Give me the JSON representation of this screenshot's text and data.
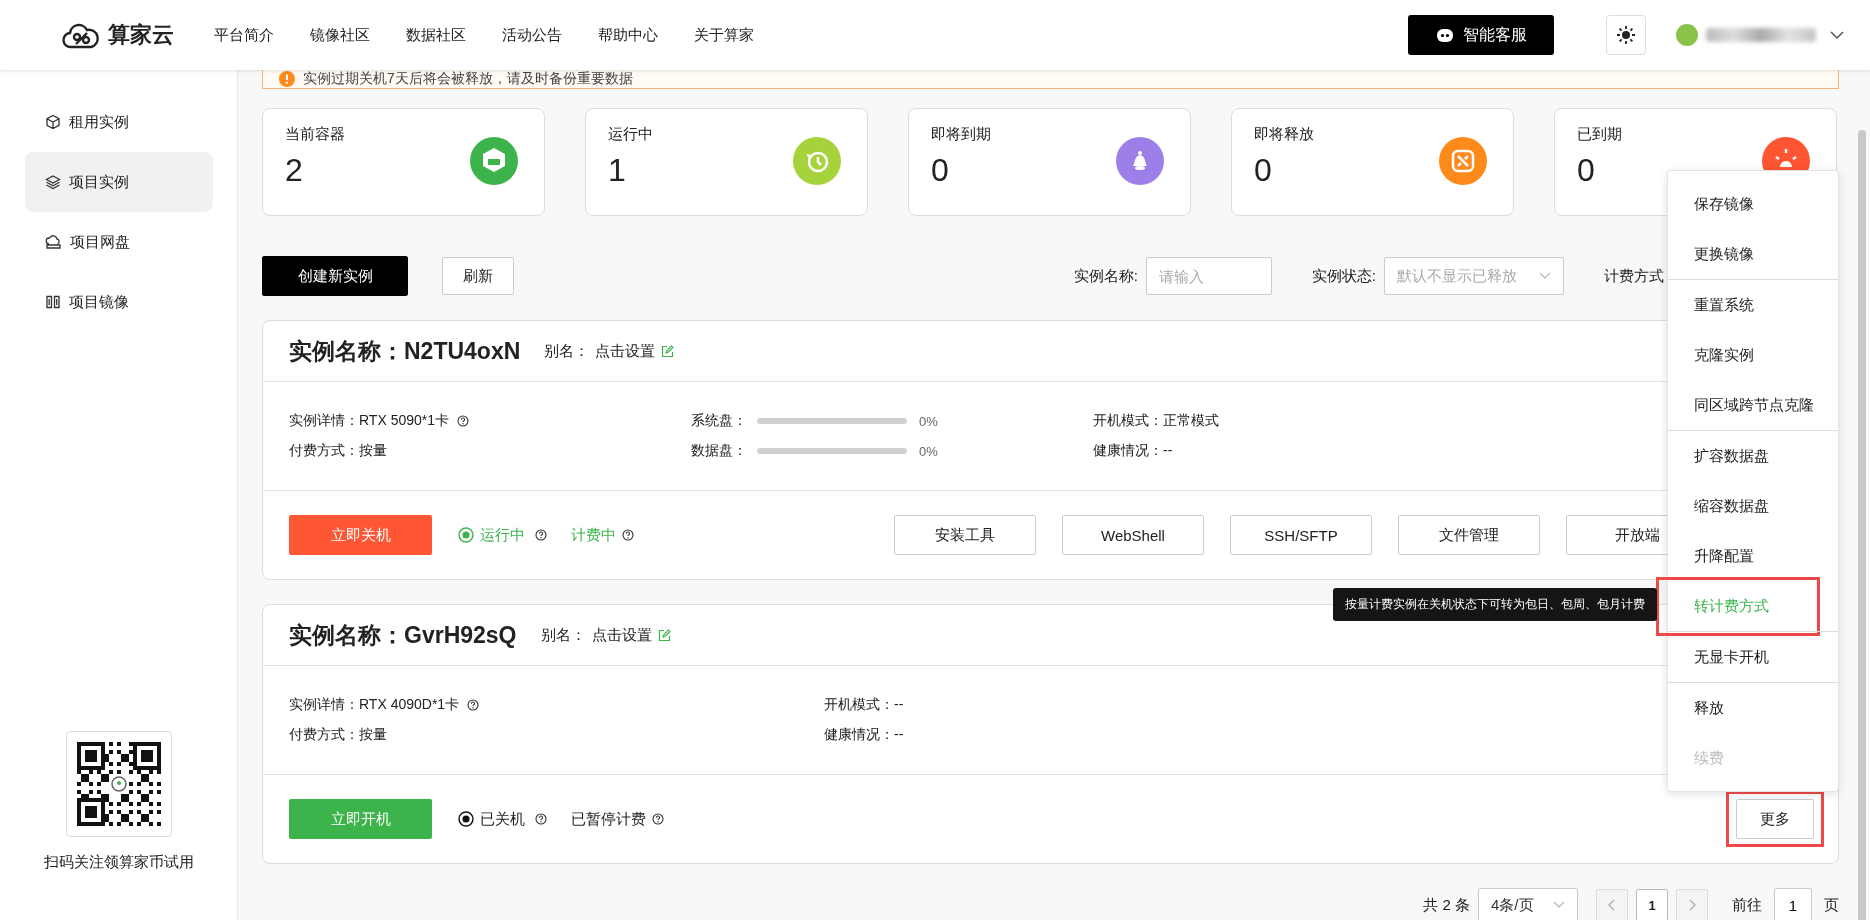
{
  "header": {
    "logo": "算家云",
    "nav": [
      "平台简介",
      "镜像社区",
      "数据社区",
      "活动公告",
      "帮助中心",
      "关于算家"
    ],
    "support_button": "智能客服"
  },
  "sidebar": {
    "items": [
      {
        "label": "租用实例",
        "selected": false
      },
      {
        "label": "项目实例",
        "selected": true
      },
      {
        "label": "项目网盘",
        "selected": false
      },
      {
        "label": "项目镜像",
        "selected": false
      }
    ],
    "promo": "扫码关注领算家币试用"
  },
  "notice": "实例过期关机7天后将会被释放，请及时备份重要数据",
  "stats": [
    {
      "label": "当前容器",
      "value": "2",
      "kind": "container",
      "color": "#3cb44b"
    },
    {
      "label": "运行中",
      "value": "1",
      "kind": "running",
      "color": "#a6d33c"
    },
    {
      "label": "即将到期",
      "value": "0",
      "kind": "expiring",
      "color": "#9d7fe9"
    },
    {
      "label": "即将释放",
      "value": "0",
      "kind": "releasing",
      "color": "#ff8a1c"
    },
    {
      "label": "已到期",
      "value": "0",
      "kind": "expired",
      "color": "#ff5533"
    }
  ],
  "toolbar": {
    "create_button": "创建新实例",
    "refresh_button": "刷新",
    "filters": [
      {
        "label": "实例名称:",
        "placeholder": "请输入",
        "kind": "input"
      },
      {
        "label": "实例状态:",
        "placeholder": "默认不显示已释放",
        "kind": "select"
      },
      {
        "label": "计费方式",
        "kind": "label"
      }
    ]
  },
  "instances": [
    {
      "title": "实例名称：N2TU4oxN",
      "alias_label": "别名：",
      "alias": "点击设置",
      "details": [
        [
          {
            "kind": "text",
            "text": "实例详情：RTX 5090*1卡",
            "help": true
          },
          {
            "kind": "text",
            "text": "付费方式：按量",
            "help": false
          }
        ],
        [
          {
            "kind": "bar",
            "label": "系统盘：",
            "level": 0,
            "reading": "0%"
          },
          {
            "kind": "bar",
            "label": "数据盘：",
            "level": 0,
            "reading": "0%"
          }
        ],
        [
          {
            "kind": "text",
            "text": "开机模式：正常模式",
            "help": false
          },
          {
            "kind": "text",
            "text": "健康情况：--",
            "help": false
          }
        ]
      ],
      "power_button": {
        "label": "立即关机",
        "kind": "stop"
      },
      "status": {
        "label": "运行中",
        "running": true
      },
      "billing": {
        "label": "计费中",
        "active": true
      },
      "actions": [
        "安装工具",
        "WebShell",
        "SSH/SFTP",
        "文件管理",
        "开放端"
      ]
    },
    {
      "title": "实例名称：GvrH92sQ",
      "alias_label": "别名：",
      "alias": "点击设置",
      "details": [
        [
          {
            "kind": "text",
            "text": "实例详情：RTX 4090D*1卡",
            "help": true
          },
          {
            "kind": "text",
            "text": "付费方式：按量",
            "help": false
          }
        ],
        [
          {
            "kind": "text",
            "text": "开机模式：--",
            "help": false
          },
          {
            "kind": "text",
            "text": "健康情况：--",
            "help": false
          }
        ]
      ],
      "power_button": {
        "label": "立即开机",
        "kind": "start"
      },
      "status": {
        "label": "已关机",
        "running": false
      },
      "billing": {
        "label": "已暂停计费",
        "active": false
      },
      "more_button": {
        "label": "更多",
        "highlighted": true
      }
    }
  ],
  "more_menu": {
    "tooltip": "按量计费实例在关机状态下可转为包日、包周、包月计费",
    "sections": [
      {
        "items": [
          {
            "label": "保存镜像",
            "active": false,
            "disabled": false,
            "highlighted": false
          },
          {
            "label": "更换镜像",
            "active": false,
            "disabled": false,
            "highlighted": false
          }
        ]
      },
      {
        "items": [
          {
            "label": "重置系统",
            "active": false,
            "disabled": false,
            "highlighted": false
          },
          {
            "label": "克隆实例",
            "active": false,
            "disabled": false,
            "highlighted": false
          },
          {
            "label": "同区域跨节点克隆",
            "active": false,
            "disabled": false,
            "highlighted": false
          }
        ]
      },
      {
        "items": [
          {
            "label": "扩容数据盘",
            "active": false,
            "disabled": false,
            "highlighted": false
          },
          {
            "label": "缩容数据盘",
            "active": false,
            "disabled": false,
            "highlighted": false
          },
          {
            "label": "升降配置",
            "active": false,
            "disabled": false,
            "highlighted": false
          },
          {
            "label": "转计费方式",
            "active": true,
            "disabled": false,
            "highlighted": true
          }
        ]
      },
      {
        "items": [
          {
            "label": "无显卡开机",
            "active": false,
            "disabled": false,
            "highlighted": false
          }
        ]
      },
      {
        "items": [
          {
            "label": "释放",
            "active": false,
            "disabled": false,
            "highlighted": false
          },
          {
            "label": "续费",
            "active": false,
            "disabled": true,
            "highlighted": false
          }
        ]
      }
    ]
  },
  "pagination": {
    "total": "共 2 条",
    "page_size": "4条/页",
    "pages": [
      {
        "label": "1",
        "selected": true
      }
    ],
    "goto_label": "前往",
    "goto_value": "1",
    "page_suffix": "页"
  }
}
